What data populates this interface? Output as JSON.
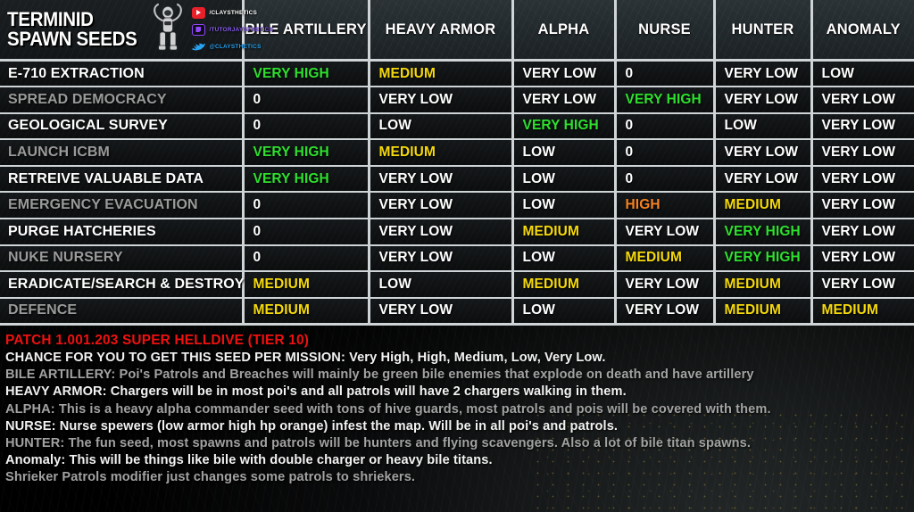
{
  "brand": {
    "title_line1": "TERMINID",
    "title_line2": "SPAWN SEEDS",
    "socials": [
      {
        "icon": "youtube-icon",
        "handle": "/CLAYSTHETICS"
      },
      {
        "icon": "twitch-icon",
        "handle": "/TUTORJAYSTHETICS"
      },
      {
        "icon": "twitter-icon",
        "handle": "@CLAYSTHETICS"
      }
    ]
  },
  "table": {
    "columns": [
      "BILE ARTILLERY",
      "HEAVY ARMOR",
      "ALPHA",
      "NURSE",
      "HUNTER",
      "ANOMALY"
    ],
    "rows": [
      {
        "mission": "E-710 EXTRACTION",
        "values": [
          "VERY HIGH",
          "MEDIUM",
          "VERY LOW",
          "0",
          "VERY LOW",
          "LOW"
        ]
      },
      {
        "mission": "SPREAD DEMOCRACY",
        "values": [
          "0",
          "VERY LOW",
          "VERY LOW",
          "VERY HIGH",
          "VERY LOW",
          "VERY LOW"
        ]
      },
      {
        "mission": "GEOLOGICAL SURVEY",
        "values": [
          "0",
          "LOW",
          "VERY HIGH",
          "0",
          "LOW",
          "VERY LOW"
        ]
      },
      {
        "mission": "LAUNCH ICBM",
        "values": [
          "VERY HIGH",
          "MEDIUM",
          "LOW",
          "0",
          "VERY LOW",
          "VERY LOW"
        ]
      },
      {
        "mission": "RETREIVE VALUABLE DATA",
        "values": [
          "VERY HIGH",
          "VERY LOW",
          "LOW",
          "0",
          "VERY LOW",
          "VERY LOW"
        ]
      },
      {
        "mission": "EMERGENCY EVACUATION",
        "values": [
          "0",
          "VERY LOW",
          "LOW",
          "HIGH",
          "MEDIUM",
          "VERY LOW"
        ]
      },
      {
        "mission": "PURGE HATCHERIES",
        "values": [
          "0",
          "VERY LOW",
          "MEDIUM",
          "VERY LOW",
          "VERY HIGH",
          "VERY LOW"
        ]
      },
      {
        "mission": "NUKE NURSERY",
        "values": [
          "0",
          "VERY LOW",
          "LOW",
          "MEDIUM",
          "VERY HIGH",
          "VERY LOW"
        ]
      },
      {
        "mission": "ERADICATE/SEARCH & DESTROY",
        "values": [
          "MEDIUM",
          "LOW",
          "MEDIUM",
          "VERY LOW",
          "MEDIUM",
          "VERY LOW"
        ]
      },
      {
        "mission": "DEFENCE",
        "values": [
          "MEDIUM",
          "VERY LOW",
          "LOW",
          "VERY LOW",
          "MEDIUM",
          "MEDIUM"
        ]
      }
    ]
  },
  "notes": [
    {
      "style": "patch",
      "text": "PATCH 1.001.203 SUPER HELLDIVE (TIER 10)"
    },
    {
      "style": "white",
      "text": "CHANCE FOR YOU TO GET THIS SEED PER MISSION: Very High, High, Medium, Low, Very Low."
    },
    {
      "style": "grey",
      "text": "BILE ARTILLERY: Poi's Patrols and Breaches will mainly be green bile enemies that explode on death and have artillery"
    },
    {
      "style": "white",
      "text": "HEAVY ARMOR: Chargers will be in most poi's and all patrols will have 2 chargers walking in them."
    },
    {
      "style": "grey",
      "text": "ALPHA: This is a heavy alpha commander seed with tons of hive guards, most patrols and pois will be covered with them."
    },
    {
      "style": "white",
      "text": "NURSE: Nurse spewers (low armor high hp orange) infest the map. Will be in all poi's and patrols."
    },
    {
      "style": "grey",
      "text": "HUNTER: The fun seed, most spawns and patrols will be hunters and flying scavengers. Also a lot of bile titan spawns."
    },
    {
      "style": "white",
      "text": "Anomaly: This will be things like bile with double charger or heavy bile titans."
    },
    {
      "style": "grey",
      "text": "Shrieker Patrols modifier just changes some patrols to shriekers."
    }
  ],
  "colors": {
    "very_high": "#2ee02e",
    "high": "#f58220",
    "medium": "#f5d90a",
    "low": "#ffffff",
    "very_low": "#ffffff",
    "zero": "#ffffff",
    "patch": "#ee1111",
    "grid": "#cfd4d6"
  }
}
